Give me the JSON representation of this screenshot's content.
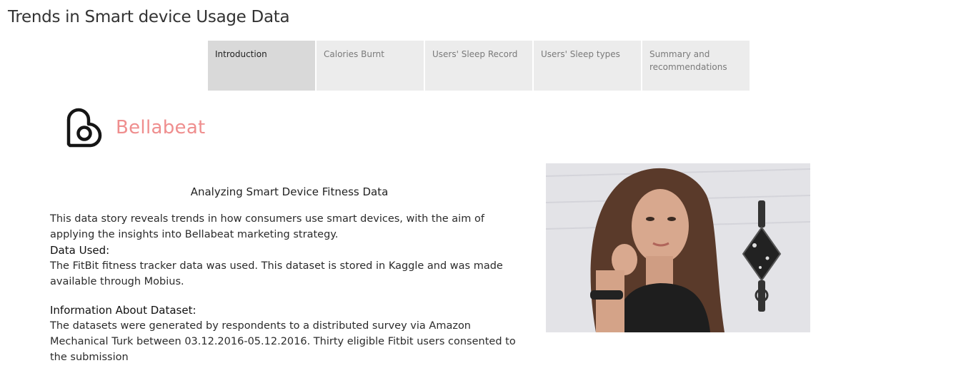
{
  "story": {
    "title": "Trends in Smart device Usage Data"
  },
  "tabs": [
    {
      "label": "Introduction",
      "active": true
    },
    {
      "label": "Calories Burnt",
      "active": false
    },
    {
      "label": "Users' Sleep Record",
      "active": false
    },
    {
      "label": "Users' Sleep types",
      "active": false
    },
    {
      "label": "Summary and recommendations",
      "active": false
    }
  ],
  "logo": {
    "text": "Bellabeat",
    "color": "#ef8e8e"
  },
  "intro": {
    "heading": "Analyzing Smart Device Fitness Data",
    "summary": "This data story  reveals trends  in how consumers use smart devices, with the aim of  applying the insights into Bellabeat marketing strategy.",
    "data_used_heading": "Data Used:",
    "data_used_text": "The FitBit fitness tracker data was used. This dataset is stored in Kaggle and was made available through Mobius.",
    "dataset_info_heading": "Information About Dataset:",
    "dataset_info_text": "The datasets were generated by respondents to a distributed survey via Amazon Mechanical Turk between 03.12.2016-05.12.2016. Thirty eligible Fitbit users consented to the submission"
  },
  "image": {
    "icon": "product-photo"
  }
}
